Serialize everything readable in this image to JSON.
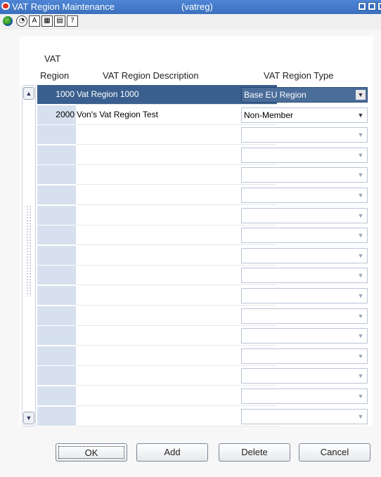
{
  "window": {
    "title": "VAT Region Maintenance",
    "form_code": "(vatreg)"
  },
  "toolbar": {
    "icons": [
      "globe-icon",
      "help-icon",
      "spell-icon",
      "calendar-icon",
      "keyboard-icon",
      "question-icon"
    ]
  },
  "table": {
    "headers": {
      "region_line1": "VAT",
      "region_line2": "Region",
      "description": "VAT Region Description",
      "type": "VAT Region Type"
    },
    "rows": [
      {
        "region": "1000",
        "description": "Vat Region 1000",
        "type": "Base EU Region",
        "selected": true
      },
      {
        "region": "2000",
        "description": "Von's Vat Region Test",
        "type": "Non-Member",
        "selected": false
      },
      {
        "region": "",
        "description": "",
        "type": ""
      },
      {
        "region": "",
        "description": "",
        "type": ""
      },
      {
        "region": "",
        "description": "",
        "type": ""
      },
      {
        "region": "",
        "description": "",
        "type": ""
      },
      {
        "region": "",
        "description": "",
        "type": ""
      },
      {
        "region": "",
        "description": "",
        "type": ""
      },
      {
        "region": "",
        "description": "",
        "type": ""
      },
      {
        "region": "",
        "description": "",
        "type": ""
      },
      {
        "region": "",
        "description": "",
        "type": ""
      },
      {
        "region": "",
        "description": "",
        "type": ""
      },
      {
        "region": "",
        "description": "",
        "type": ""
      },
      {
        "region": "",
        "description": "",
        "type": ""
      },
      {
        "region": "",
        "description": "",
        "type": ""
      },
      {
        "region": "",
        "description": "",
        "type": ""
      },
      {
        "region": "",
        "description": "",
        "type": ""
      }
    ]
  },
  "buttons": {
    "ok": "OK",
    "add": "Add",
    "delete": "Delete",
    "cancel": "Cancel"
  }
}
